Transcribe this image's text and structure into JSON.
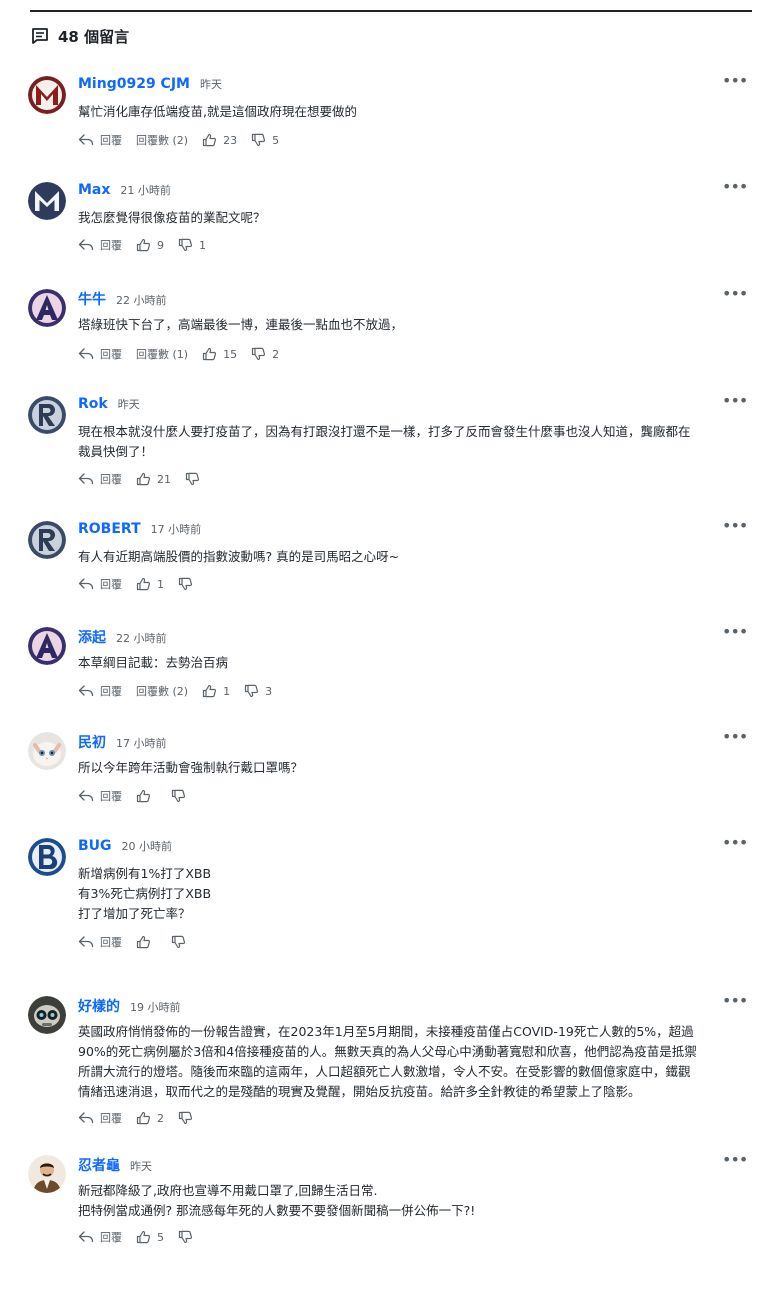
{
  "header": {
    "count_label": "48 個留言"
  },
  "labels": {
    "reply": "回覆",
    "more": "•••"
  },
  "colors": {
    "author": "#0f69ff",
    "meta": "#5b636a",
    "text": "#232a31"
  },
  "comments": [
    {
      "author": "Ming0929 CJM",
      "time": "昨天",
      "avatar": "letter-M",
      "lines": [
        "幫忙消化庫存低端疫苗,就是這個政府現在想要做的"
      ],
      "replies_label": "回覆數 (2)",
      "likes": "23",
      "dislikes": "5"
    },
    {
      "author": "Max",
      "time": "21 小時前",
      "avatar": "letter-M-dark",
      "lines": [
        "我怎麼覺得很像疫苗的業配文呢？"
      ],
      "replies_label": "",
      "likes": "9",
      "dislikes": "1"
    },
    {
      "author": "牛牛",
      "time": "22 小時前",
      "avatar": "letter-A",
      "lines": [
        "塔綠班快下台了，高端最後一博，連最後一點血也不放過，"
      ],
      "replies_label": "回覆數 (1)",
      "likes": "15",
      "dislikes": "2"
    },
    {
      "author": "Rok",
      "time": "昨天",
      "avatar": "letter-R",
      "lines": [
        "現在根本就沒什麼人要打疫苗了，因為有打跟沒打還不是一樣，打多了反而會發生什麼事也沒人知道，龔廠都在",
        "裁員快倒了！"
      ],
      "replies_label": "",
      "likes": "21",
      "dislikes": ""
    },
    {
      "author": "ROBERT",
      "time": "17 小時前",
      "avatar": "letter-R",
      "lines": [
        "有人有近期高端股價的指數波動嗎? 真的是司馬昭之心呀~"
      ],
      "replies_label": "",
      "likes": "1",
      "dislikes": ""
    },
    {
      "author": "添起",
      "time": "22 小時前",
      "avatar": "letter-A",
      "lines": [
        "本草綱目記載：去勢治百病"
      ],
      "replies_label": "回覆數 (2)",
      "likes": "1",
      "dislikes": "3"
    },
    {
      "author": "民初",
      "time": "17 小時前",
      "avatar": "kitten-photo",
      "lines": [
        "所以今年跨年活動會強制執行戴口罩嗎？"
      ],
      "replies_label": "",
      "likes": "",
      "dislikes": ""
    },
    {
      "author": "BUG",
      "time": "20 小時前",
      "avatar": "letter-B",
      "lines": [
        "新增病例有1%打了XBB",
        "有3%死亡病例打了XBB",
        "打了增加了死亡率？"
      ],
      "replies_label": "",
      "likes": "",
      "dislikes": ""
    },
    {
      "author": "好樣的",
      "time": "19 小時前",
      "avatar": "robot-photo",
      "lines": [
        "英國政府悄悄發佈的一份報告證實，在2023年1月至5月期間，未接種疫苗僅占COVID-19死亡人數的5%，超過",
        "90%的死亡病例屬於3倍和4倍接種疫苗的人。無數天真的為人父母心中湧動著寬慰和欣喜，他們認為疫苗是抵禦",
        "所謂大流行的燈塔。隨後而來臨的這兩年，人口超額死亡人數激增，令人不安。在受影響的數個億家庭中，鐵觀",
        "情緒迅速消退，取而代之的是殘酷的現實及覺醒，開始反抗疫苗。給許多全針教徒的希望蒙上了陰影。"
      ],
      "replies_label": "",
      "likes": "2",
      "dislikes": ""
    },
    {
      "author": "忍者龜",
      "time": "昨天",
      "avatar": "man-photo",
      "lines": [
        "新冠都降級了,政府也宣導不用戴口罩了,回歸生活日常.",
        "把特例當成通例? 那流感每年死的人數要不要發個新聞稿一併公佈一下?!"
      ],
      "replies_label": "",
      "likes": "5",
      "dislikes": ""
    }
  ]
}
